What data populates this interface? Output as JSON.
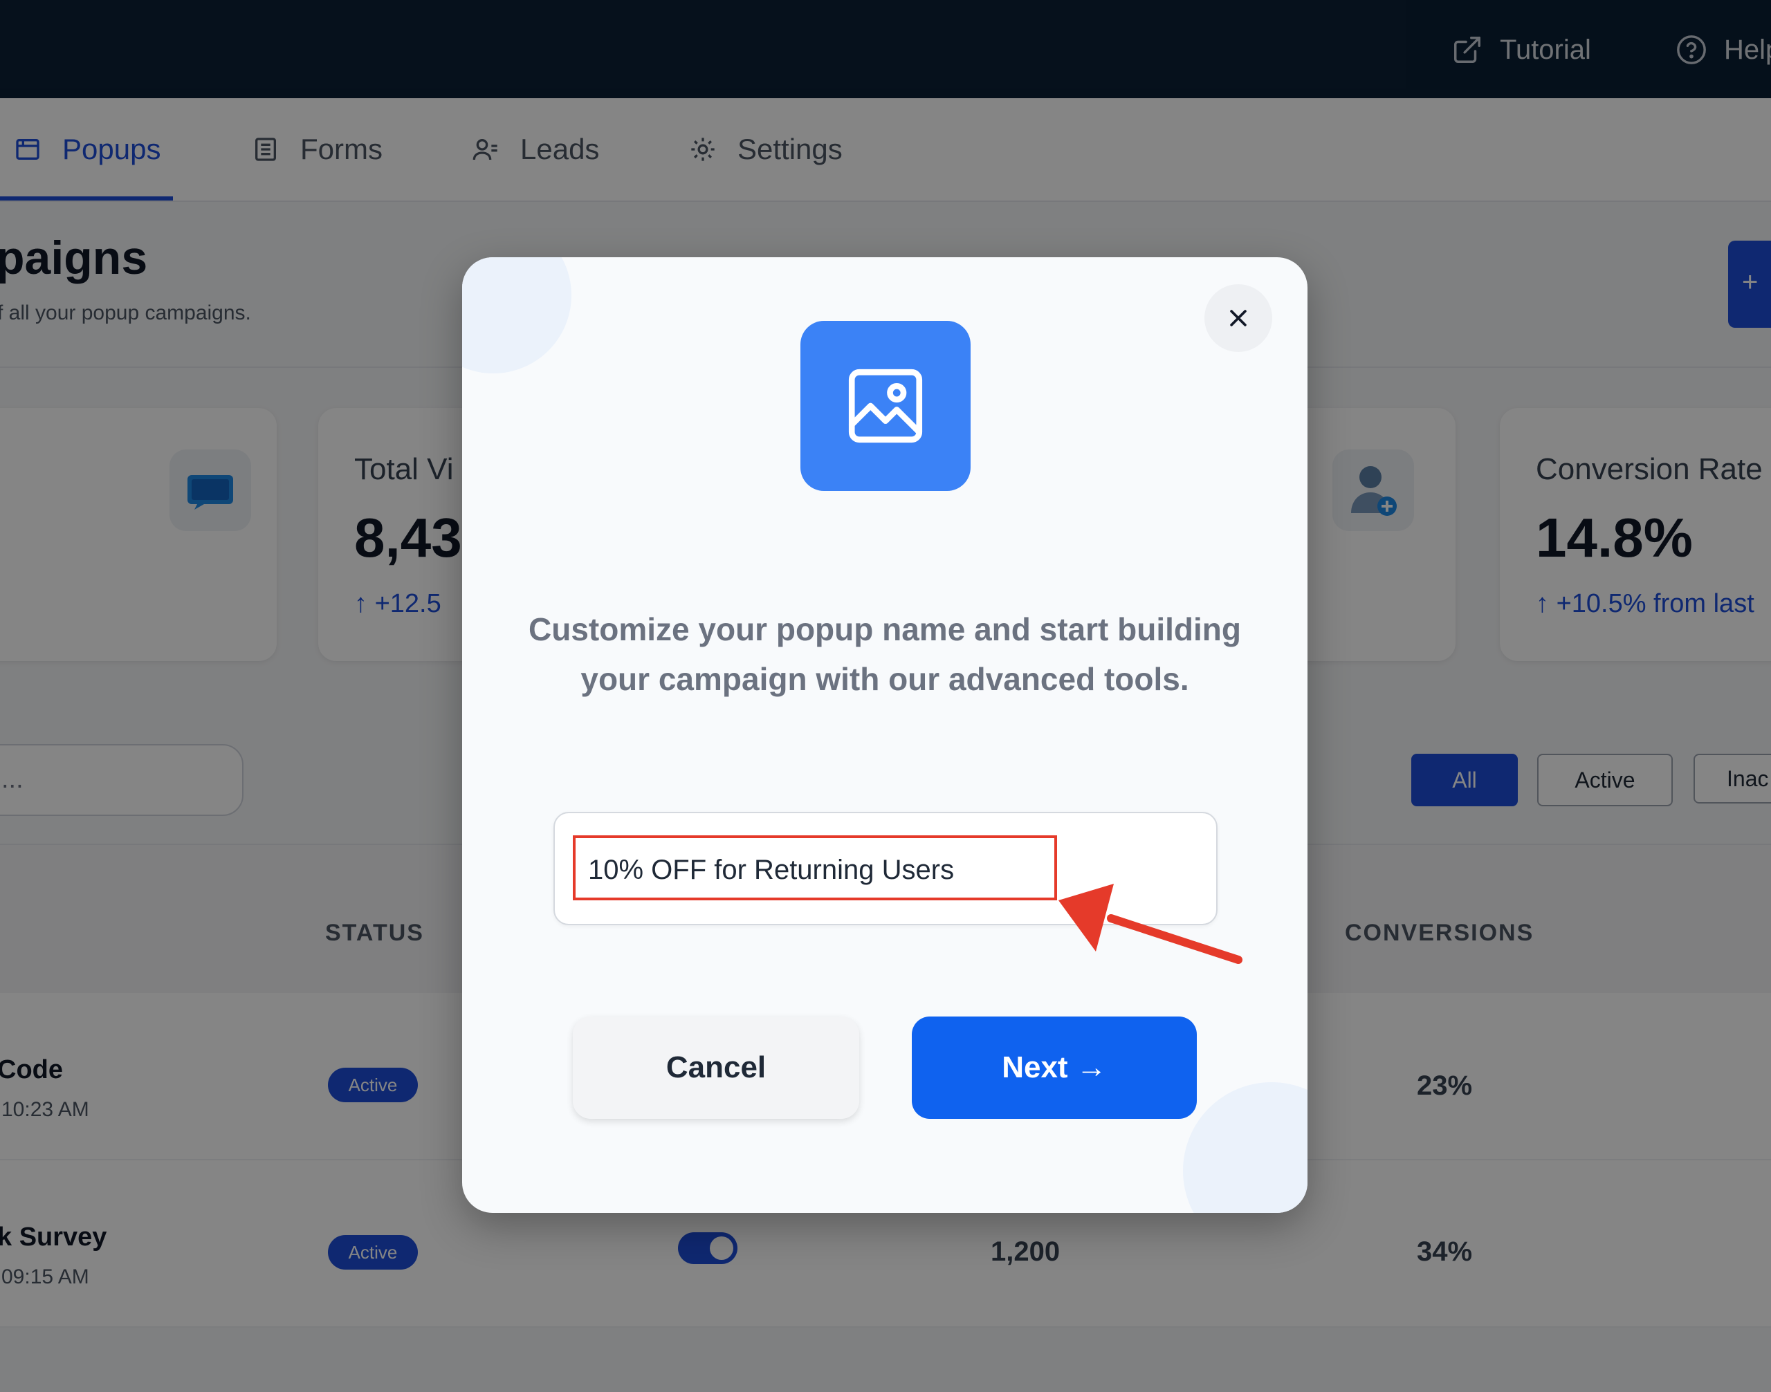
{
  "topbar": {
    "tutorial_label": "Tutorial",
    "help_label": "Help",
    "tutorial_icon": "external-link-icon",
    "help_icon": "help-circle-icon"
  },
  "tabs": [
    {
      "label": "Popups",
      "icon": "window-icon",
      "active": true
    },
    {
      "label": "Forms",
      "icon": "document-icon",
      "active": false
    },
    {
      "label": "Leads",
      "icon": "users-icon",
      "active": false
    },
    {
      "label": "Settings",
      "icon": "gear-icon",
      "active": false
    }
  ],
  "page": {
    "title": "paigns",
    "subtitle": "f all your popup campaigns.",
    "create_button": "+"
  },
  "stats": [
    {
      "label": "",
      "value": "",
      "change": "",
      "icon": "chat-icon"
    },
    {
      "label": "Total Vi",
      "value": "8,43",
      "change": "+12.5",
      "icon": ""
    },
    {
      "label": "",
      "value": "",
      "change": "",
      "icon": "add-user-icon"
    },
    {
      "label": "Conversion Rate",
      "value": "14.8%",
      "change": "+10.5% from last",
      "icon": ""
    }
  ],
  "search": {
    "placeholder": "..."
  },
  "filters": [
    {
      "label": "All",
      "active": true
    },
    {
      "label": "Active",
      "active": false
    },
    {
      "label": "Inac",
      "active": false
    }
  ],
  "table": {
    "headers": {
      "status": "STATUS",
      "conversions": "CONVERSIONS"
    },
    "rows": [
      {
        "name": "Code",
        "date": "10:23 AM",
        "status": "Active",
        "views": "",
        "conversions": "23%"
      },
      {
        "name": "k Survey",
        "date": "09:15 AM",
        "status": "Active",
        "views": "1,200",
        "conversions": "34%"
      }
    ]
  },
  "modal": {
    "icon": "image-icon",
    "description": "Customize your popup name and start building your campaign with our advanced tools.",
    "name_input_value": "10% OFF for Returning Users",
    "cancel_label": "Cancel",
    "next_label": "Next →",
    "close_icon": "close-icon"
  },
  "colors": {
    "accent": "#1d4ed8",
    "next_button": "#0f62ef",
    "hero_icon": "#3b82f6",
    "annotation": "#e53a2a",
    "topbar": "#0b2035"
  }
}
